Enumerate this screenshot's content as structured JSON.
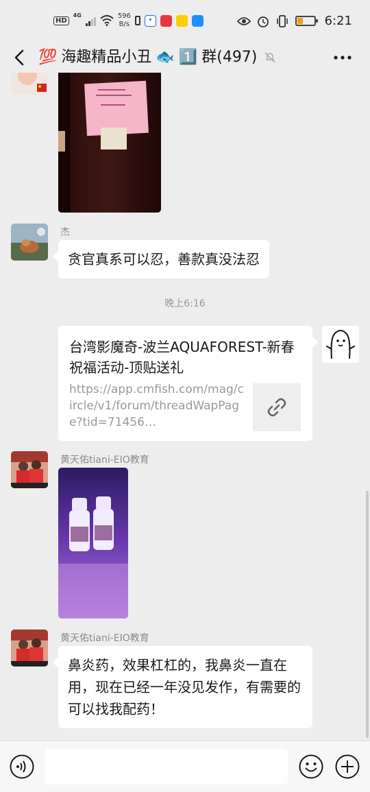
{
  "status_bar": {
    "hd": "HD",
    "network": "4G",
    "speed_value": "596",
    "speed_unit": "B/s",
    "app_icons": [
      "baidu-icon",
      "toutiao-icon",
      "taobao-icon",
      "kuwo-icon"
    ],
    "time": "6:21",
    "battery_level": 0.35
  },
  "header": {
    "title_emoji": "💯",
    "title_text": "海趣精品小丑",
    "title_fish": "🐟",
    "title_badge": "1️⃣",
    "title_group": "群(497)"
  },
  "messages": [
    {
      "type": "image",
      "subject": "elevator door with pink notice"
    },
    {
      "type": "text",
      "sender": "杰",
      "text": "贪官真系可以忍，善款真没法忍"
    },
    {
      "type": "timestamp",
      "text": "晚上6:16"
    },
    {
      "type": "link",
      "title": "台湾影魔奇-波兰AQUAFOREST-新春祝福活动-顶贴送礼",
      "url": "https://app.cmfish.com/mag/circle/v1/forum/threadWapPage?tid=71456…",
      "thumb_icon": "link-icon"
    },
    {
      "type": "image",
      "sender": "黄天佑tiani-EIO教育",
      "subject": "two small medicine bottles"
    },
    {
      "type": "text",
      "sender": "黄天佑tiani-EIO教育",
      "text": "鼻炎药，效果杠杠的，我鼻炎一直在用，现在已经一年没见发作，有需要的可以找我配药！"
    }
  ],
  "input_bar": {
    "value": "",
    "icons": [
      "voice-icon",
      "emoji-icon",
      "plus-icon"
    ]
  },
  "colors": {
    "background": "#ededed",
    "bubble": "#ffffff",
    "sender": "#8a8a8a",
    "link_url": "#999999",
    "battery": "#f39c12"
  }
}
